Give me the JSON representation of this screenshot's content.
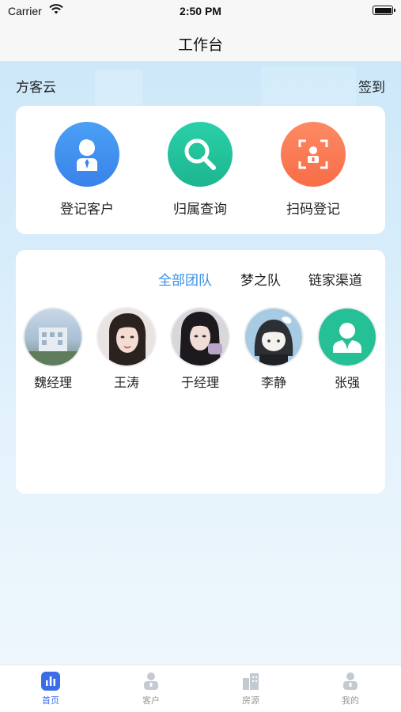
{
  "status_bar": {
    "carrier": "Carrier",
    "time": "2:50 PM"
  },
  "nav": {
    "title": "工作台"
  },
  "header": {
    "brand": "方客云",
    "checkin": "签到"
  },
  "actions": [
    {
      "label": "登记客户",
      "icon": "person-tie-icon",
      "color": "#3f8ff0"
    },
    {
      "label": "归属查询",
      "icon": "search-icon",
      "color": "#21c29a"
    },
    {
      "label": "扫码登记",
      "icon": "scan-icon",
      "color": "#fb7c56"
    }
  ],
  "team_tabs": [
    {
      "label": "全部团队",
      "active": true
    },
    {
      "label": "梦之队",
      "active": false
    },
    {
      "label": "链家渠道",
      "active": false
    }
  ],
  "members": [
    {
      "name": "魏经理",
      "avatar": "building-photo"
    },
    {
      "name": "王涛",
      "avatar": "woman-photo"
    },
    {
      "name": "于经理",
      "avatar": "woman-photo"
    },
    {
      "name": "李静",
      "avatar": "anime-girl-photo"
    },
    {
      "name": "张强",
      "avatar": "default-user-icon"
    }
  ],
  "tab_bar": [
    {
      "label": "首页",
      "icon": "chart-icon",
      "active": true
    },
    {
      "label": "客户",
      "icon": "customer-icon",
      "active": false
    },
    {
      "label": "房源",
      "icon": "building-icon",
      "active": false
    },
    {
      "label": "我的",
      "icon": "profile-icon",
      "active": false
    }
  ],
  "colors": {
    "accent": "#3a8ee6",
    "tab_active": "#3a6de8",
    "tab_inactive": "#999999"
  }
}
